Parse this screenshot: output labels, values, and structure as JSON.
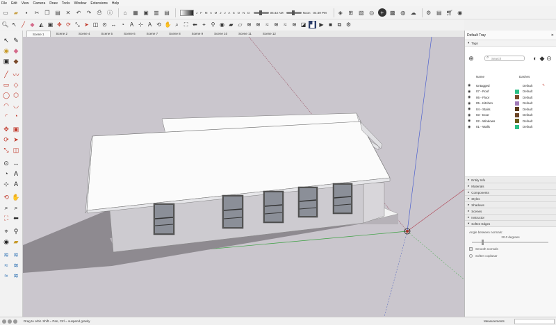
{
  "menu": [
    "File",
    "Edit",
    "View",
    "Camera",
    "Draw",
    "Tools",
    "Window",
    "Extensions",
    "Help"
  ],
  "shadow_settings": {
    "months": "J F M A M J J A S O N D",
    "time_start": "06:43 AM",
    "time_mid": "Noon",
    "time_end": "04:49 PM"
  },
  "scenes": [
    "Scene 1",
    "Scene 2",
    "Scene 4",
    "Scene 5",
    "Scene 6",
    "Scene 7",
    "Scene 8",
    "Scene 9",
    "Scene 10",
    "Scene 11",
    "Scene 12"
  ],
  "active_scene": "Scene 1",
  "tray": {
    "title": "Default Tray",
    "tags": {
      "title": "Tags",
      "search_placeholder": "Search",
      "col_name": "Name",
      "col_dashes": "Dashes",
      "rows": [
        {
          "name": "Untagged",
          "dashes": "Default",
          "color": "#ffffff"
        },
        {
          "name": "07 - Roof",
          "dashes": "Default",
          "color": "#2bbf86"
        },
        {
          "name": "06 - Floor",
          "dashes": "Default",
          "color": "#7a4a2a"
        },
        {
          "name": "05 - Kitchen",
          "dashes": "Default",
          "color": "#a07ab8"
        },
        {
          "name": "04 - Stairs",
          "dashes": "Default",
          "color": "#5a3a1a"
        },
        {
          "name": "03 - Door",
          "dashes": "Default",
          "color": "#6b4426"
        },
        {
          "name": "02 - Windows",
          "dashes": "Default",
          "color": "#6b5a1a"
        },
        {
          "name": "01 - Walls",
          "dashes": "Default",
          "color": "#2bbf86"
        }
      ]
    },
    "sections": [
      "Entity Info",
      "Materials",
      "Components",
      "Styles",
      "Shadows",
      "Scenes",
      "Instructor",
      "Soften Edges"
    ],
    "soften": {
      "angle_label": "Angle between normals:",
      "angle_value": "20.0 degrees",
      "smooth_label": "Smooth normals",
      "coplanar_label": "Soften coplanar"
    }
  },
  "status": {
    "message": "Drag to orbit. Shift = Pan, Ctrl = suspend gravity",
    "measurements_label": "Measurements"
  },
  "colors": {
    "sky": "#cac6cd",
    "roof": "#fbfbfb",
    "wall": "#cdcbd0",
    "shadow": "#8e8a90",
    "ground_shadow": "#b2aeb4"
  }
}
